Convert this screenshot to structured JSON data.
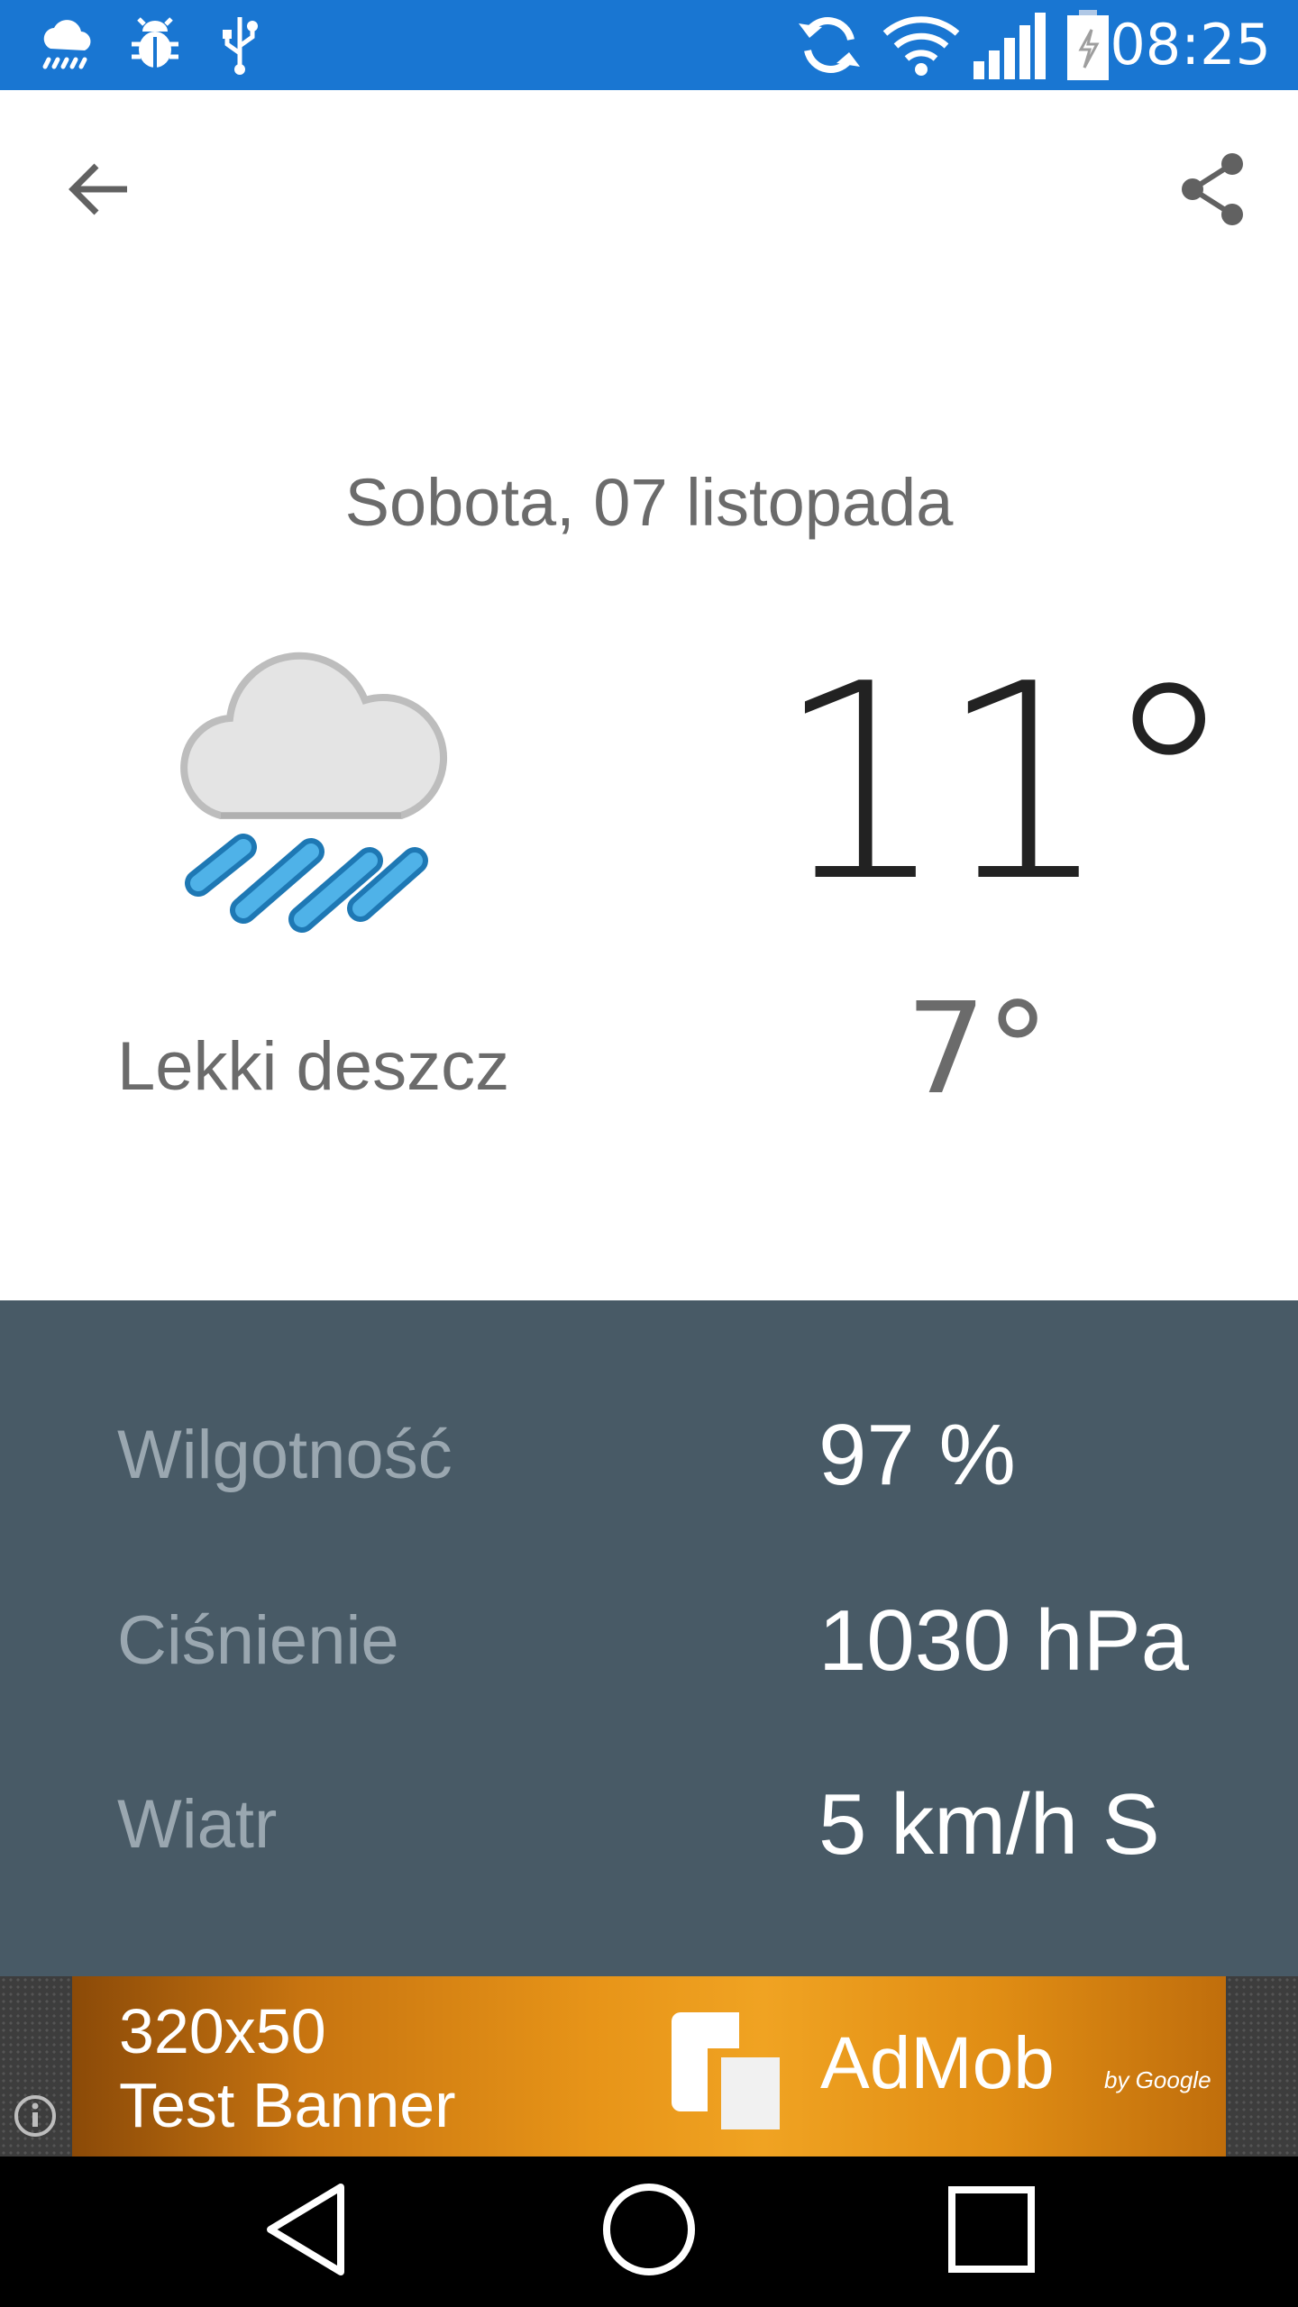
{
  "status_bar": {
    "time": "08:25",
    "left_icons": [
      "weather-notification-icon",
      "debug-bug-icon",
      "usb-icon"
    ],
    "right_icons": [
      "sync-icon",
      "wifi-icon",
      "signal-icon",
      "battery-charging-icon"
    ]
  },
  "toolbar": {
    "back_icon": "arrow-back-icon",
    "share_icon": "share-icon"
  },
  "forecast": {
    "date": "Sobota, 07 listopada",
    "condition": "Lekki deszcz",
    "temp_high": "11°",
    "temp_low": "7°",
    "icon": "light-rain-icon"
  },
  "details": [
    {
      "label": "Wilgotność",
      "value": "97 %"
    },
    {
      "label": "Ciśnienie",
      "value": "1030 hPa"
    },
    {
      "label": "Wiatr",
      "value": "5 km/h S"
    }
  ],
  "ad": {
    "line1": "320x50",
    "line2": "Test Banner",
    "brand": "AdMob",
    "by": "by Google"
  },
  "colors": {
    "status_bar": "#1976d2",
    "details_bg": "#485a66",
    "detail_label": "#9aa7b0",
    "rain": "#2f95d4"
  }
}
